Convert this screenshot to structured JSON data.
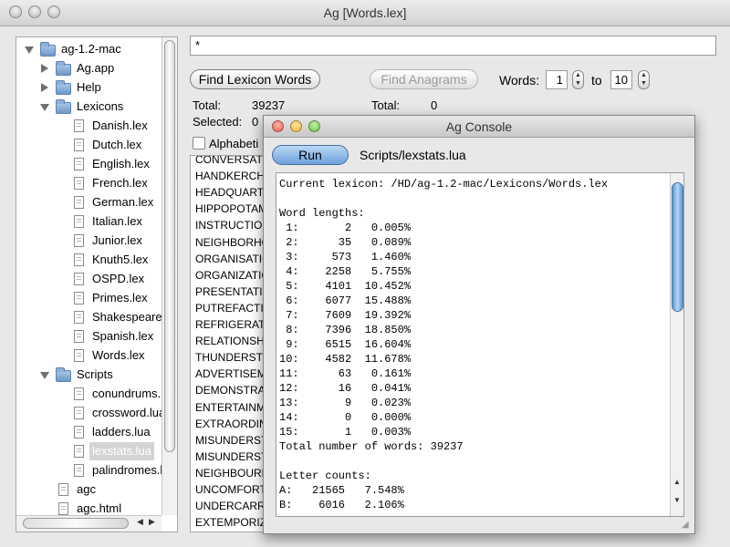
{
  "window": {
    "title": "Ag [Words.lex]"
  },
  "tree": {
    "items": [
      {
        "label": "ag-1.2-mac",
        "type": "folder",
        "level": 0,
        "expanded": true
      },
      {
        "label": "Ag.app",
        "type": "folder",
        "level": 1,
        "expanded": false
      },
      {
        "label": "Help",
        "type": "folder",
        "level": 1,
        "expanded": false
      },
      {
        "label": "Lexicons",
        "type": "folder",
        "level": 1,
        "expanded": true
      },
      {
        "label": "Danish.lex",
        "type": "file",
        "level": 2
      },
      {
        "label": "Dutch.lex",
        "type": "file",
        "level": 2
      },
      {
        "label": "English.lex",
        "type": "file",
        "level": 2
      },
      {
        "label": "French.lex",
        "type": "file",
        "level": 2
      },
      {
        "label": "German.lex",
        "type": "file",
        "level": 2
      },
      {
        "label": "Italian.lex",
        "type": "file",
        "level": 2
      },
      {
        "label": "Junior.lex",
        "type": "file",
        "level": 2
      },
      {
        "label": "Knuth5.lex",
        "type": "file",
        "level": 2
      },
      {
        "label": "OSPD.lex",
        "type": "file",
        "level": 2
      },
      {
        "label": "Primes.lex",
        "type": "file",
        "level": 2
      },
      {
        "label": "Shakespeare.lex",
        "type": "file",
        "level": 2
      },
      {
        "label": "Spanish.lex",
        "type": "file",
        "level": 2
      },
      {
        "label": "Words.lex",
        "type": "file",
        "level": 2
      },
      {
        "label": "Scripts",
        "type": "folder",
        "level": 1,
        "expanded": true
      },
      {
        "label": "conundrums.lua",
        "type": "file",
        "level": 2
      },
      {
        "label": "crossword.lua",
        "type": "file",
        "level": 2
      },
      {
        "label": "ladders.lua",
        "type": "file",
        "level": 2
      },
      {
        "label": "lexstats.lua",
        "type": "file",
        "level": 2,
        "selected": true
      },
      {
        "label": "palindromes.lua",
        "type": "file",
        "level": 2
      },
      {
        "label": "agc",
        "type": "file",
        "level": 1
      },
      {
        "label": "agc.html",
        "type": "file",
        "level": 1
      }
    ]
  },
  "search": {
    "value": "*"
  },
  "buttons": {
    "find_lexicon": "Find Lexicon Words",
    "find_anagrams": "Find Anagrams"
  },
  "words_range": {
    "label": "Words:",
    "from": "1",
    "to_label": "to",
    "to": "10"
  },
  "stats": {
    "total_label": "Total:",
    "total_value": "39237",
    "selected_label": "Selected:",
    "selected_value": "0",
    "anagram_total_label": "Total:",
    "anagram_total_value": "0"
  },
  "alphabetic_label": "Alphabeti",
  "word_list": [
    "CONVERSATIO",
    "HANDKERCHIE",
    "HEADQUARTER",
    "HIPPOPOTAM",
    "INSTRUCTION",
    "NEIGHBORHO",
    "ORGANISATIO",
    "ORGANIZATIO",
    "PRESENTATIO",
    "PUTREFACTIO",
    "REFRIGERATO",
    "RELATIONSHI",
    "THUNDERSTO",
    "ADVERTISEME",
    "DEMONSTRAT",
    "ENTERTAINME",
    "EXTRAORDINA",
    "MISUNDERSTA",
    "MISUNDERSTO",
    "NEIGHBOURHO",
    "UNCOMFORTA",
    "UNDERCARRIA",
    "EXTEMPORIZA"
  ],
  "console": {
    "title": "Ag Console",
    "run_label": "Run",
    "script_path": "Scripts/lexstats.lua",
    "output": [
      "Current lexicon: /HD/ag-1.2-mac/Lexicons/Words.lex",
      "",
      "Word lengths:",
      " 1:       2   0.005%",
      " 2:      35   0.089%",
      " 3:     573   1.460%",
      " 4:    2258   5.755%",
      " 5:    4101  10.452%",
      " 6:    6077  15.488%",
      " 7:    7609  19.392%",
      " 8:    7396  18.850%",
      " 9:    6515  16.604%",
      "10:    4582  11.678%",
      "11:      63   0.161%",
      "12:      16   0.041%",
      "13:       9   0.023%",
      "14:       0   0.000%",
      "15:       1   0.003%",
      "Total number of words: 39237",
      "",
      "Letter counts:",
      "A:   21565   7.548%",
      "B:    6016   2.106%"
    ]
  },
  "colors": {
    "close": "#ed5c52",
    "minimize": "#f4b73c",
    "zoom": "#67c545",
    "selection": "#d4d4d4",
    "run_button": "#7fb0e4"
  }
}
